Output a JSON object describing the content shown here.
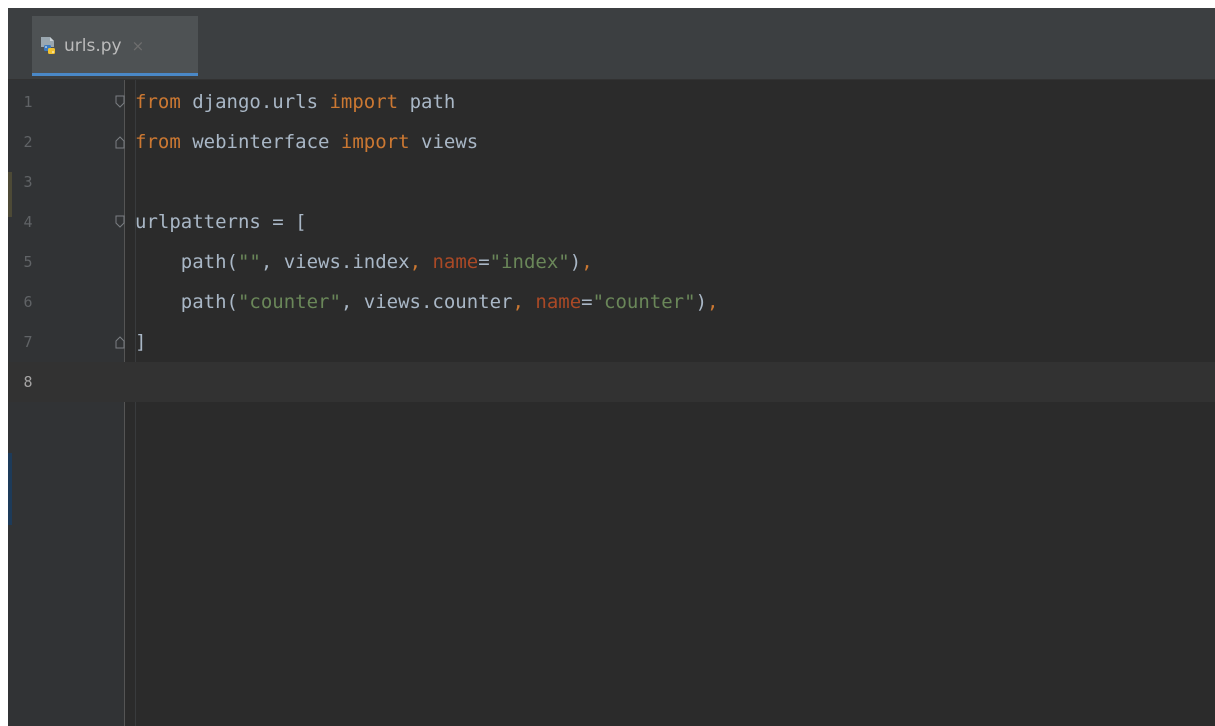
{
  "tab": {
    "filename": "urls.py",
    "close_glyph": "×",
    "icon": "python-file-icon"
  },
  "colors": {
    "keyword": "#cc7832",
    "identifier": "#a9b7c6",
    "string": "#6a8759",
    "param": "#aa4926",
    "gutter_number": "#606366",
    "background": "#2b2b2b"
  },
  "lines": [
    {
      "num": "1",
      "tokens": [
        {
          "t": "from",
          "c": "keyword"
        },
        {
          "t": " django.urls ",
          "c": "identifier"
        },
        {
          "t": "import",
          "c": "keyword"
        },
        {
          "t": " path",
          "c": "identifier"
        }
      ]
    },
    {
      "num": "2",
      "tokens": [
        {
          "t": "from",
          "c": "keyword"
        },
        {
          "t": " webinterface ",
          "c": "identifier"
        },
        {
          "t": "import",
          "c": "keyword"
        },
        {
          "t": " views",
          "c": "identifier"
        }
      ]
    },
    {
      "num": "3",
      "tokens": []
    },
    {
      "num": "4",
      "tokens": [
        {
          "t": "urlpatterns = [",
          "c": "identifier"
        }
      ]
    },
    {
      "num": "5",
      "tokens": [
        {
          "t": "    path(",
          "c": "identifier"
        },
        {
          "t": "\"\"",
          "c": "string"
        },
        {
          "t": ", views.index",
          "c": "identifier"
        },
        {
          "t": ", ",
          "c": "keyword"
        },
        {
          "t": "name",
          "c": "param"
        },
        {
          "t": "=",
          "c": "identifier"
        },
        {
          "t": "\"index\"",
          "c": "string"
        },
        {
          "t": ")",
          "c": "identifier"
        },
        {
          "t": ",",
          "c": "keyword"
        }
      ]
    },
    {
      "num": "6",
      "tokens": [
        {
          "t": "    path(",
          "c": "identifier"
        },
        {
          "t": "\"counter\"",
          "c": "string"
        },
        {
          "t": ", views.counter",
          "c": "identifier"
        },
        {
          "t": ", ",
          "c": "keyword"
        },
        {
          "t": "name",
          "c": "param"
        },
        {
          "t": "=",
          "c": "identifier"
        },
        {
          "t": "\"counter\"",
          "c": "string"
        },
        {
          "t": ")",
          "c": "identifier"
        },
        {
          "t": ",",
          "c": "keyword"
        }
      ]
    },
    {
      "num": "7",
      "tokens": [
        {
          "t": "]",
          "c": "identifier"
        }
      ]
    },
    {
      "num": "8",
      "tokens": []
    }
  ],
  "current_line": "8"
}
